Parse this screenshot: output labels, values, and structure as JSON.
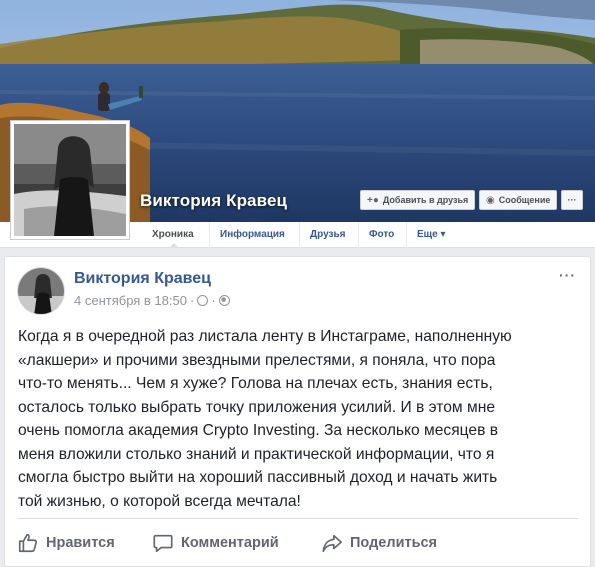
{
  "profile": {
    "name": "Виктория Кравец"
  },
  "cover_buttons": {
    "add_friend": "Добавить в друзья",
    "message": "Сообщение",
    "more": "···"
  },
  "nav": {
    "tabs": [
      "Хроника",
      "Информация",
      "Друзья",
      "Фото",
      "Еще ▾"
    ]
  },
  "post": {
    "author": "Виктория Кравец",
    "date": "4 сентября в 18:50",
    "meta_sep": "·",
    "more": "···",
    "text_lines": [
      "Когда я в очередной раз листала ленту в Инстаграме, наполненную",
      "«лакшери» и прочими звездными прелестями, я поняла, что пора",
      "что-то менять... Чем я хуже? Голова на плечах есть, знания есть,",
      "осталось только выбрать точку приложения усилий. И в этом мне",
      "очень помогла академия Crypto Investing. За несколько месяцев в",
      "меня вложили столько знаний и практической информации, что я",
      "смогла быстро выйти на хороший пассивный доход и начать жить",
      "той жизнью, о которой всегда мечтала!"
    ]
  },
  "actions": {
    "like": "Нравится",
    "comment": "Комментарий",
    "share": "Поделиться"
  },
  "icons": {
    "add_friend": "add-friend-icon",
    "message": "messenger-icon",
    "clock": "clock-icon",
    "privacy": "globe-icon",
    "like": "thumbs-up-icon",
    "comment": "speech-bubble-icon",
    "share": "share-arrow-icon"
  },
  "colors": {
    "link": "#365899",
    "text": "#1d2129",
    "muted": "#90949c",
    "background": "#e9ebee"
  }
}
